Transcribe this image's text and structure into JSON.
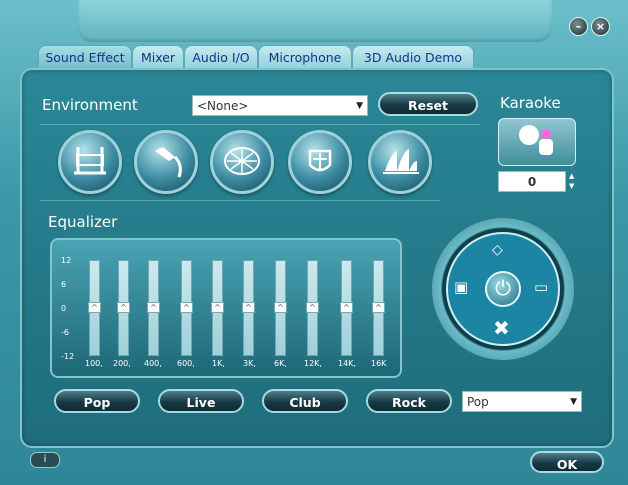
{
  "tabs": [
    "Sound Effect",
    "Mixer",
    "Audio I/O",
    "Microphone",
    "3D Audio Demo"
  ],
  "environment": {
    "title": "Environment",
    "select_value": "<None>",
    "reset_label": "Reset",
    "icons": [
      "bathroom-icon",
      "shower-icon",
      "stadium-icon",
      "colosseum-icon",
      "opera-house-icon"
    ]
  },
  "karaoke": {
    "title": "Karaoke",
    "value": "0"
  },
  "equalizer": {
    "title": "Equalizer",
    "scale": [
      "12",
      "6",
      "0",
      "-6",
      "-12"
    ],
    "bands": [
      {
        "freq": "100,",
        "level": 0
      },
      {
        "freq": "200,",
        "level": 0
      },
      {
        "freq": "400,",
        "level": 0
      },
      {
        "freq": "600,",
        "level": 0
      },
      {
        "freq": "1K,",
        "level": 0
      },
      {
        "freq": "3K,",
        "level": 0
      },
      {
        "freq": "6K,",
        "level": 0
      },
      {
        "freq": "12K,",
        "level": 0
      },
      {
        "freq": "14K,",
        "level": 0
      },
      {
        "freq": "16K",
        "level": 0
      }
    ],
    "presets": [
      "Pop",
      "Live",
      "Club",
      "Rock"
    ],
    "preset_select": "Pop"
  },
  "footer": {
    "info_label": "i",
    "ok_label": "OK"
  }
}
